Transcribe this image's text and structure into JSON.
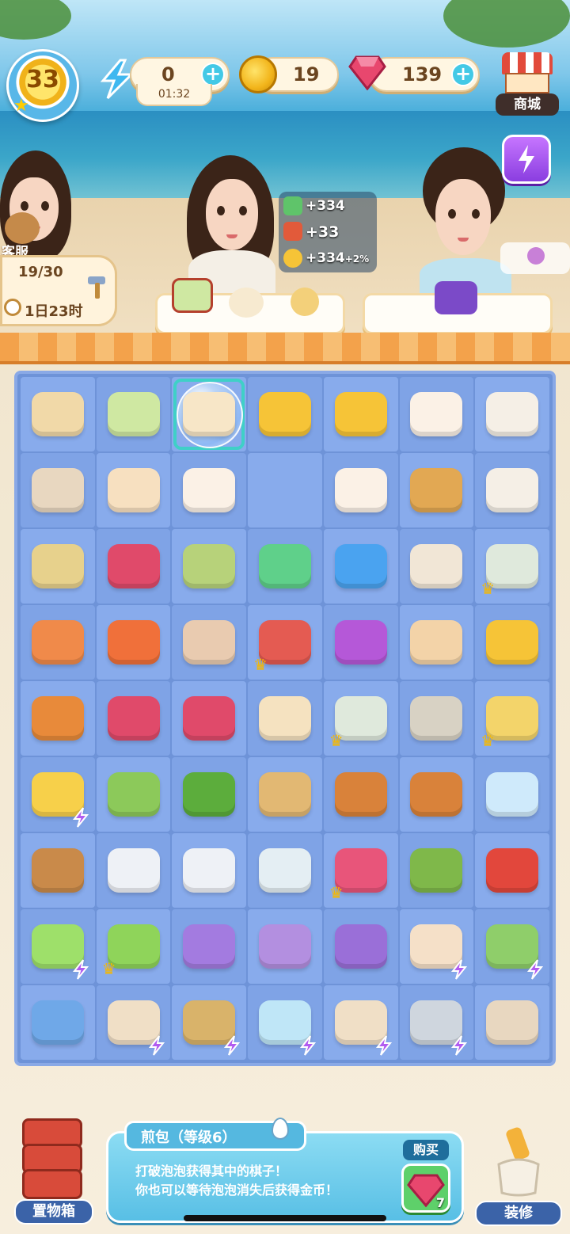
{
  "hud": {
    "level": "33",
    "energy_value": "0",
    "energy_timer": "01:32",
    "coins": "19",
    "gems": "139",
    "shop_label": "商城"
  },
  "customer_service": {
    "label": "客服",
    "count": "19/30",
    "time_left": "1日23时"
  },
  "order_rewards": [
    {
      "icon": "blocks-icon",
      "text": "+334"
    },
    {
      "icon": "firecracker-icon",
      "text": "+33"
    },
    {
      "icon": "coin-icon",
      "text": "+334",
      "bonus": "+2%"
    }
  ],
  "board": {
    "rows": [
      [
        {
          "icon": "flower-cake-icon",
          "c": "#f1d9a8"
        },
        {
          "icon": "layered-cake-icon",
          "c": "#cfe8a2"
        },
        {
          "icon": "pan-bun-icon",
          "c": "#f7e6c7",
          "bubble": true
        },
        {
          "icon": "coins-stack-icon",
          "c": "#f6c437"
        },
        {
          "icon": "coin-icon",
          "c": "#f6c437"
        },
        {
          "icon": "steamed-bun-icon",
          "c": "#fbf1e6"
        },
        {
          "icon": "tea-bowl-icon",
          "c": "#f5efe6"
        }
      ],
      [
        {
          "icon": "frying-pan-icon",
          "c": "#e8d7c0"
        },
        {
          "icon": "sesame-bun-icon",
          "c": "#f7e0c0"
        },
        {
          "icon": "bun-icon",
          "c": "#fbf1e6"
        },
        null,
        {
          "icon": "cream-bun-icon",
          "c": "#fbf1e6"
        },
        {
          "icon": "corn-steamer-icon",
          "c": "#e2a853"
        },
        {
          "icon": "soup-bowl-icon",
          "c": "#f5efe6"
        }
      ],
      [
        {
          "icon": "strainer-icon",
          "c": "#e7d18c"
        },
        {
          "icon": "ruby-gems-icon",
          "c": "#e04a6a"
        },
        {
          "icon": "shrimp-leaf-icon",
          "c": "#b7d27a"
        },
        {
          "icon": "green-orb-icon",
          "c": "#5fd08a"
        },
        {
          "icon": "blue-orb-icon",
          "c": "#4aa3f0"
        },
        {
          "icon": "fish-dish-icon",
          "c": "#f1e6d6"
        },
        {
          "icon": "tea-set-icon",
          "c": "#dfe9dc",
          "crown": true
        }
      ],
      [
        {
          "icon": "peach-icon",
          "c": "#f08a4a"
        },
        {
          "icon": "orange-icon",
          "c": "#f0703a"
        },
        {
          "icon": "paper-bag-icon",
          "c": "#e9cbb0"
        },
        {
          "icon": "treasure-chest-red-icon",
          "c": "#e45b52",
          "crown": true
        },
        {
          "icon": "treasure-chest-purple-icon",
          "c": "#b558d8"
        },
        {
          "icon": "popsicle-icon",
          "c": "#f3d3a8"
        },
        {
          "icon": "gold-coins-pile-icon",
          "c": "#f6c437"
        }
      ],
      [
        {
          "icon": "crab-plate-icon",
          "c": "#e88a3a"
        },
        {
          "icon": "ruby-icon",
          "c": "#e04a6a"
        },
        {
          "icon": "ruby-cluster-icon",
          "c": "#e04a6a"
        },
        {
          "icon": "egg-roll-icon",
          "c": "#f5e2c0"
        },
        {
          "icon": "tea-set-icon",
          "c": "#dfe9dc",
          "crown": true
        },
        {
          "icon": "oyster-icon",
          "c": "#d8d2c4"
        },
        {
          "icon": "corn-soup-icon",
          "c": "#f3d46a",
          "crown": true
        }
      ],
      [
        {
          "icon": "sand-bucket-icon",
          "c": "#f7d04a",
          "bolt": true
        },
        {
          "icon": "cabbage-icon",
          "c": "#8cc95a"
        },
        {
          "icon": "cucumber-icon",
          "c": "#5cad3c"
        },
        {
          "icon": "spatula-icon",
          "c": "#e2b873"
        },
        {
          "icon": "roast-duck-icon",
          "c": "#d9823a"
        },
        {
          "icon": "roast-fish-icon",
          "c": "#d9823a"
        },
        {
          "icon": "ice-cubes-icon",
          "c": "#cfeafb"
        }
      ],
      [
        {
          "icon": "hourglass-icon",
          "c": "#c98a4a"
        },
        {
          "icon": "white-bowl-icon",
          "c": "#eef1f6"
        },
        {
          "icon": "flower-plate-icon",
          "c": "#eef1f6"
        },
        {
          "icon": "porcelain-bowl-icon",
          "c": "#e4eef3"
        },
        {
          "icon": "dragon-fruit-icon",
          "c": "#e8557a",
          "crown": true
        },
        {
          "icon": "green-teapot-icon",
          "c": "#7fb84a"
        },
        {
          "icon": "strawberry-icon",
          "c": "#e2473c"
        }
      ],
      [
        {
          "icon": "lantern-icon",
          "c": "#9ee06a",
          "bolt": true
        },
        {
          "icon": "lime-slice-icon",
          "c": "#8fd45a",
          "crown": true
        },
        {
          "icon": "lotion-bottle-icon",
          "c": "#a37be0"
        },
        {
          "icon": "cosmetic-jar-icon",
          "c": "#b38fe0"
        },
        {
          "icon": "perfume-icon",
          "c": "#9a6fd8"
        },
        {
          "icon": "sandwich-icon",
          "c": "#f5e0c8",
          "bolt": true
        },
        {
          "icon": "vegetable-basket-icon",
          "c": "#8fce6a",
          "bolt": true
        }
      ],
      [
        {
          "icon": "fridge-icon",
          "c": "#6fa8e8"
        },
        {
          "icon": "soup-pot-icon",
          "c": "#f0dfc6",
          "bolt": true
        },
        {
          "icon": "cherry-basket-icon",
          "c": "#d9b36a",
          "bolt": true
        },
        {
          "icon": "fishbowl-icon",
          "c": "#bfe6f7",
          "bolt": true
        },
        {
          "icon": "soup-pot-icon",
          "c": "#f0dfc6",
          "bolt": true
        },
        {
          "icon": "cherry-pan-icon",
          "c": "#cfd6de",
          "bolt": true
        },
        {
          "icon": "colander-icon",
          "c": "#e8d7c0"
        }
      ]
    ]
  },
  "info_panel": {
    "title": "煎包（等级6）",
    "line1": "打破泡泡获得其中的棋子！",
    "line2": "你也可以等待泡泡消失后获得金币！",
    "buy_label": "购买",
    "buy_cost": "7"
  },
  "bottom": {
    "storage_label": "置物箱",
    "decor_label": "装修"
  }
}
